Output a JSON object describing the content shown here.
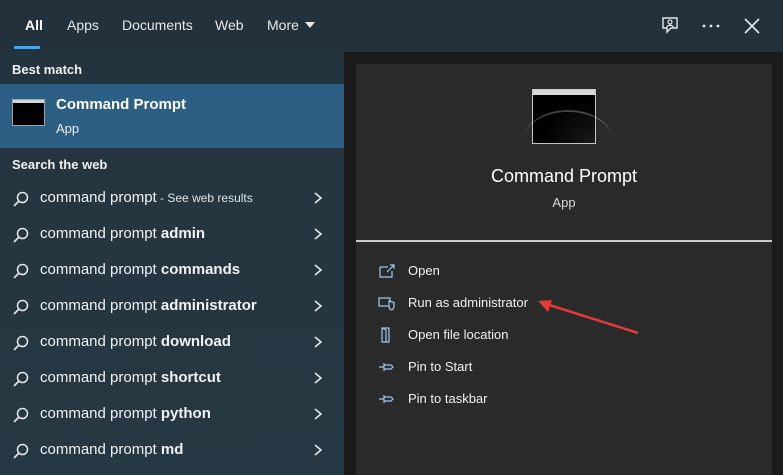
{
  "tabs": [
    {
      "label": "All"
    },
    {
      "label": "Apps"
    },
    {
      "label": "Documents"
    },
    {
      "label": "Web"
    },
    {
      "label": "More"
    }
  ],
  "topbar": {
    "feedback_icon": "feedback-icon",
    "more_icon": "ellipsis-icon",
    "close_icon": "close-icon"
  },
  "left": {
    "best_match_label": "Best match",
    "best_match": {
      "title": "Command Prompt",
      "subtitle": "App",
      "icon": "terminal-icon"
    },
    "search_web_label": "Search the web",
    "web_results": [
      {
        "base": "command prompt",
        "bold": "",
        "suffix": " - See web results"
      },
      {
        "base": "command prompt ",
        "bold": "admin",
        "suffix": ""
      },
      {
        "base": "command prompt ",
        "bold": "commands",
        "suffix": ""
      },
      {
        "base": "command prompt ",
        "bold": "administrator",
        "suffix": ""
      },
      {
        "base": "command prompt ",
        "bold": "download",
        "suffix": ""
      },
      {
        "base": "command prompt ",
        "bold": "shortcut",
        "suffix": ""
      },
      {
        "base": "command prompt ",
        "bold": "python",
        "suffix": ""
      },
      {
        "base": "command prompt ",
        "bold": "md",
        "suffix": ""
      }
    ]
  },
  "right": {
    "title": "Command Prompt",
    "subtitle": "App",
    "actions": [
      {
        "label": "Open",
        "icon": "open-icon"
      },
      {
        "label": "Run as administrator",
        "icon": "shield-icon"
      },
      {
        "label": "Open file location",
        "icon": "folder-icon"
      },
      {
        "label": "Pin to Start",
        "icon": "pin-icon"
      },
      {
        "label": "Pin to taskbar",
        "icon": "pin-icon"
      }
    ]
  },
  "colors": {
    "accent": "#4aa7ea",
    "selected_row": "#2d5e83",
    "annotation_arrow": "#e03a3a"
  }
}
